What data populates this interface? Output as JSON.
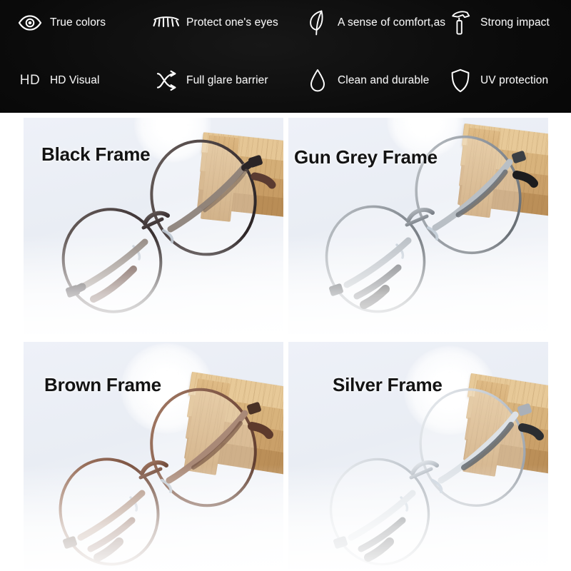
{
  "banner": {
    "background_color": "#0a0a0a",
    "text_color": "#f4f4f4",
    "rows": [
      [
        {
          "icon": "eye-icon",
          "label": "True colors"
        },
        {
          "icon": "eyelash-icon",
          "label": "Protect one's eyes"
        },
        {
          "icon": "feather-icon",
          "label": "A sense of comfort,as"
        },
        {
          "icon": "hammer-icon",
          "label": "Strong impact"
        }
      ],
      [
        {
          "icon": "hd-text-icon",
          "label": "HD Visual"
        },
        {
          "icon": "shuffle-arrows-icon",
          "label": "Full glare barrier"
        },
        {
          "icon": "water-droplet-icon",
          "label": "Clean and durable"
        },
        {
          "icon": "shield-icon",
          "label": "UV protection"
        }
      ]
    ],
    "hd_icon_text": "HD"
  },
  "product_grid": {
    "cards": [
      {
        "label": "Black Frame",
        "metal_light": "#6d6360",
        "metal_mid": "#43393a",
        "metal_dark": "#241e1f",
        "temple_tip": "#5a3b31"
      },
      {
        "label": "Gun Grey Frame",
        "metal_light": "#c2c7cc",
        "metal_mid": "#8c9299",
        "metal_dark": "#5c6268",
        "temple_tip": "#1c1c1e"
      },
      {
        "label": "Brown Frame",
        "metal_light": "#a9806a",
        "metal_mid": "#7c5443",
        "metal_dark": "#563628",
        "temple_tip": "#5d3a2c"
      },
      {
        "label": "Silver Frame",
        "metal_light": "#eef1f4",
        "metal_mid": "#c3c9d0",
        "metal_dark": "#8e959d",
        "temple_tip": "#2b2d31"
      }
    ],
    "wood_color_light": "#e3c291",
    "wood_color_mid": "#cfa86f",
    "wood_color_dark": "#a87f49",
    "background_color": "#eef1f7"
  }
}
